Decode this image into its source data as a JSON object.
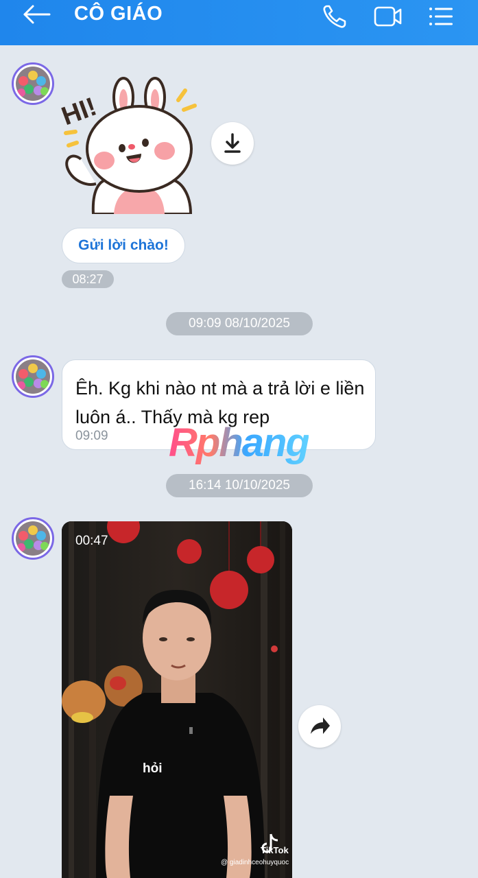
{
  "header": {
    "title": "CÔ GIÁO",
    "icons": [
      "back-arrow-icon",
      "phone-icon",
      "video-call-icon",
      "menu-list-icon"
    ],
    "color": "#1f86ec"
  },
  "messages": {
    "sticker": {
      "greet_button": "Gửi lời chào!",
      "time": "08:27"
    },
    "divider_1": "09:09 08/10/2025",
    "text_message": {
      "text": "Êh. Kg khi nào nt mà a trả lời e liền luôn á.. Thấy mà kg rep",
      "time": "09:09"
    },
    "divider_2": "16:14 10/10/2025",
    "video_message": {
      "duration": "00:47",
      "caption": "hỏi",
      "platform": "TikTok",
      "handle": "@ giadinhceohuyquoc"
    }
  },
  "watermark": "Rphang"
}
